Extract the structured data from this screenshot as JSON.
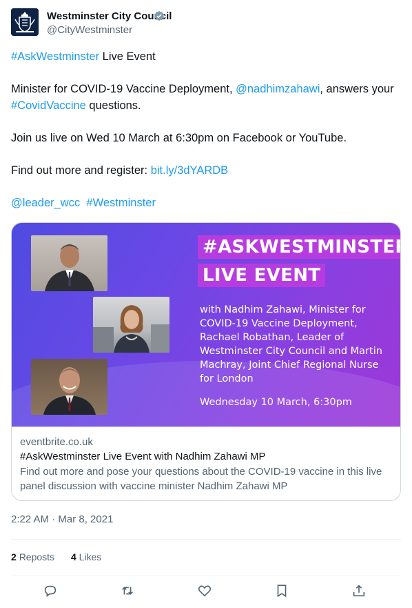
{
  "author": {
    "name": "Westminster City Council",
    "handle": "@CityWestminster",
    "verified": true,
    "avatar_icon": "crest-icon"
  },
  "tweet": {
    "line1_hashtag": "#AskWestminster",
    "line1_text": " Live Event",
    "para2_text_a": "Minister for COVID-19 Vaccine Deployment, ",
    "para2_mention": "@nadhimzahawi",
    "para2_text_b": ", answers your ",
    "para2_hashtag": "#CovidVaccine",
    "para2_text_c": " questions.",
    "para3": "Join us live on Wed 10 March at 6:30pm on Facebook or YouTube.",
    "para4_text": "Find out more and register: ",
    "para4_link": "bit.ly/3dYARDB",
    "mention_leader": "@leader_wcc",
    "hashtag_westminster": "#Westminster"
  },
  "card": {
    "promo_title_1": "#ASKWESTMINSTER",
    "promo_title_2": "LIVE EVENT",
    "promo_description": "with Nadhim Zahawi, Minister for COVID-19 Vaccine Deployment, Rachael Robathan, Leader of Westminster City Council and Martin Machray, Joint Chief Regional Nurse for London",
    "promo_date": "Wednesday 10 March, 6:30pm",
    "domain": "eventbrite.co.uk",
    "title": "#AskWestminster Live Event with Nadhim Zahawi MP",
    "description": "Find out more and pose your questions about the COVID-19 vaccine in this live panel discussion with vaccine minister Nadhim Zahawi MP"
  },
  "timestamp": "2:22 AM · Mar 8, 2021",
  "stats": {
    "reposts_count": "2",
    "reposts_label": "Reposts",
    "likes_count": "4",
    "likes_label": "Likes"
  },
  "actions": [
    "reply-icon",
    "repost-icon",
    "like-icon",
    "bookmark-icon",
    "share-icon"
  ],
  "colors": {
    "link": "#1d9bf0",
    "verified_badge": "#829aab",
    "promo_gradient_start": "#4f4be0",
    "promo_gradient_end": "#9d37d8",
    "promo_title_highlight": "#b73ce0"
  }
}
